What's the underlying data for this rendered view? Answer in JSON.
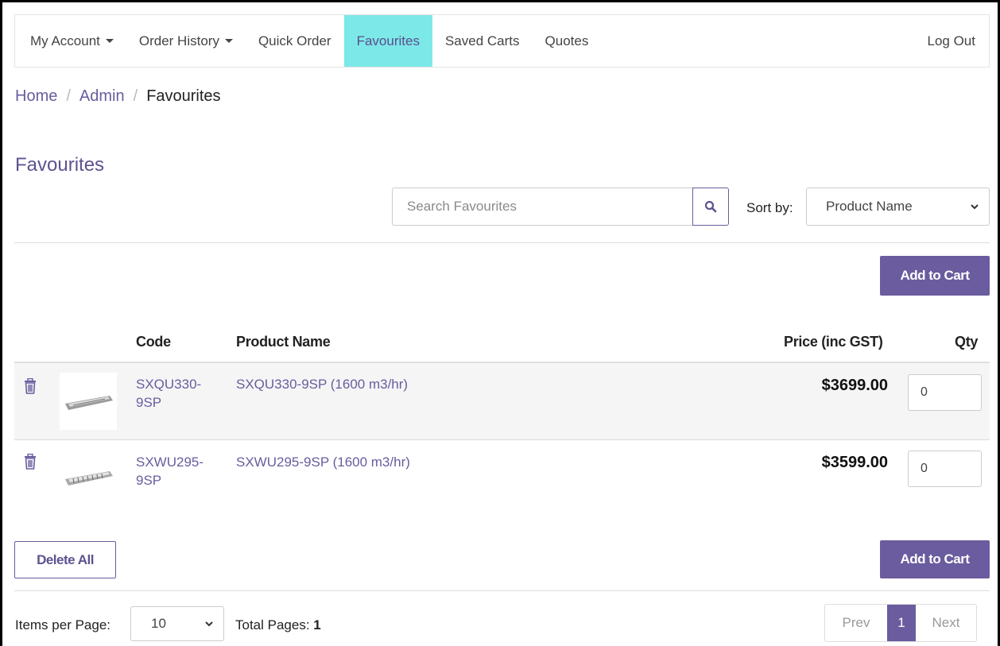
{
  "nav": {
    "items": [
      {
        "label": "My Account",
        "dropdown": true
      },
      {
        "label": "Order History",
        "dropdown": true
      },
      {
        "label": "Quick Order",
        "dropdown": false
      },
      {
        "label": "Favourites",
        "dropdown": false,
        "active": true
      },
      {
        "label": "Saved Carts",
        "dropdown": false
      },
      {
        "label": "Quotes",
        "dropdown": false
      }
    ],
    "logout": "Log Out"
  },
  "breadcrumb": {
    "items": [
      "Home",
      "Admin"
    ],
    "current": "Favourites",
    "separator": "/"
  },
  "page_title": "Favourites",
  "search": {
    "placeholder": "Search Favourites",
    "value": ""
  },
  "sort": {
    "label": "Sort by:",
    "selected": "Product Name"
  },
  "add_to_cart_label": "Add to Cart",
  "table": {
    "headers": {
      "code": "Code",
      "name": "Product Name",
      "price": "Price (inc GST)",
      "qty": "Qty"
    },
    "rows": [
      {
        "code": "SXQU330-9SP",
        "code_line1": "SXQU330-",
        "code_line2": "9SP",
        "name": "SXQU330-9SP (1600 m3/hr)",
        "price": "$3699.00",
        "qty": "0"
      },
      {
        "code": "SXWU295-9SP",
        "code_line1": "SXWU295-",
        "code_line2": "9SP",
        "name": "SXWU295-9SP (1600 m3/hr)",
        "price": "$3599.00",
        "qty": "0"
      }
    ]
  },
  "delete_all_label": "Delete All",
  "footer": {
    "items_per_page_label": "Items per Page:",
    "items_per_page": "10",
    "total_pages_label": "Total Pages:",
    "total_pages": "1"
  },
  "pagination": {
    "prev": "Prev",
    "current": "1",
    "next": "Next"
  },
  "colors": {
    "accent": "#6a5c9e",
    "active_nav": "#7de8e8"
  },
  "icons": {
    "search": "search-icon",
    "trash": "trash-icon",
    "caret": "caret-down-icon",
    "chevron": "chevron-down-icon"
  }
}
